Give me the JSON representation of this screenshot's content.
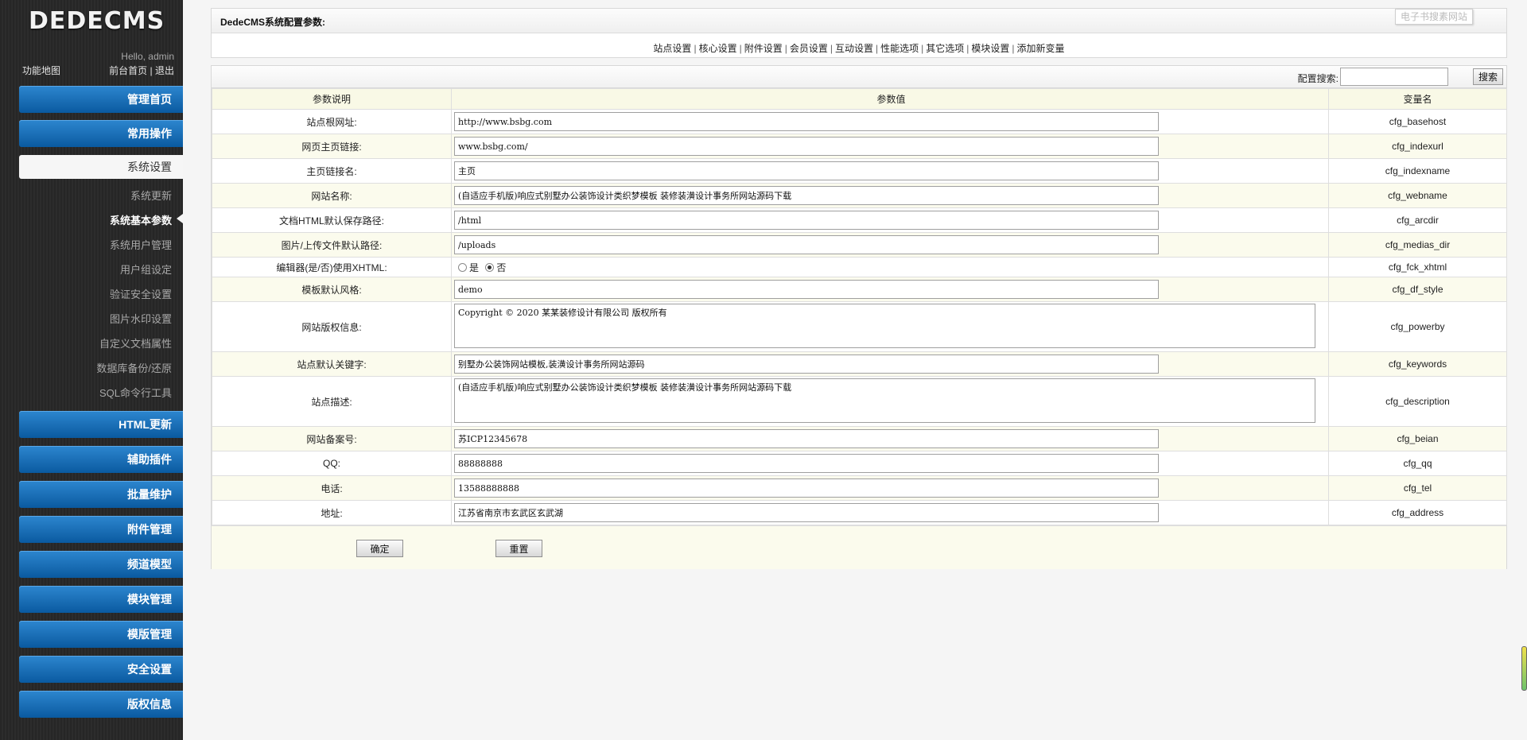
{
  "sidebar": {
    "logo": "DEDECMS",
    "hello": "Hello, admin",
    "sitemap": "功能地图",
    "frontpage": "前台首页",
    "link_sep": "|",
    "logout": "退出",
    "menu_top": [
      {
        "label": "管理首页"
      },
      {
        "label": "常用操作"
      }
    ],
    "system_settings": "系统设置",
    "sub_items": [
      {
        "label": "系统更新"
      },
      {
        "label": "系统基本参数"
      },
      {
        "label": "系统用户管理"
      },
      {
        "label": "用户组设定"
      },
      {
        "label": "验证安全设置"
      },
      {
        "label": "图片水印设置"
      },
      {
        "label": "自定义文档属性"
      },
      {
        "label": "数据库备份/还原"
      },
      {
        "label": "SQL命令行工具"
      }
    ],
    "current_sub": "系统基本参数",
    "menu_bottom": [
      {
        "label": "HTML更新"
      },
      {
        "label": "辅助插件"
      },
      {
        "label": "批量维护"
      },
      {
        "label": "附件管理"
      },
      {
        "label": "频道模型"
      },
      {
        "label": "模块管理"
      },
      {
        "label": "模版管理"
      },
      {
        "label": "安全设置"
      },
      {
        "label": "版权信息"
      }
    ]
  },
  "header": {
    "title": "DedeCMS系统配置参数:",
    "watermark": "电子书搜素网站",
    "tab_sep": "|",
    "tabs": [
      {
        "label": "站点设置"
      },
      {
        "label": "核心设置"
      },
      {
        "label": "附件设置"
      },
      {
        "label": "会员设置"
      },
      {
        "label": "互动设置"
      },
      {
        "label": "性能选项"
      },
      {
        "label": "其它选项"
      },
      {
        "label": "模块设置"
      },
      {
        "label": "添加新变量"
      }
    ]
  },
  "search": {
    "label": "配置搜索:",
    "value": "",
    "button": "搜索"
  },
  "table": {
    "headers": {
      "desc": "参数说明",
      "value": "参数值",
      "var": "变量名"
    },
    "rows": [
      {
        "desc": "站点根网址:",
        "value": "http://www.bsbg.com",
        "var": "cfg_basehost"
      },
      {
        "desc": "网页主页链接:",
        "value": "www.bsbg.com/",
        "var": "cfg_indexurl"
      },
      {
        "desc": "主页链接名:",
        "value": "主页",
        "var": "cfg_indexname"
      },
      {
        "desc": "网站名称:",
        "value": "(自适应手机版)响应式别墅办公装饰设计类织梦模板 装修装潢设计事务所网站源码下载",
        "var": "cfg_webname"
      },
      {
        "desc": "文档HTML默认保存路径:",
        "value": "/html",
        "var": "cfg_arcdir"
      },
      {
        "desc": "图片/上传文件默认路径:",
        "value": "/uploads",
        "var": "cfg_medias_dir"
      },
      {
        "desc": "编辑器(是/否)使用XHTML:",
        "radio_yes": "是",
        "radio_no": "否",
        "var": "cfg_fck_xhtml"
      },
      {
        "desc": "模板默认风格:",
        "value": "demo",
        "var": "cfg_df_style"
      },
      {
        "desc": "网站版权信息:",
        "value": "Copyright © 2020 某某装修设计有限公司 版权所有",
        "var": "cfg_powerby"
      },
      {
        "desc": "站点默认关键字:",
        "value": "别墅办公装饰网站模板,装潢设计事务所网站源码",
        "var": "cfg_keywords"
      },
      {
        "desc": "站点描述:",
        "value": "(自适应手机版)响应式别墅办公装饰设计类织梦模板 装修装潢设计事务所网站源码下载",
        "var": "cfg_description"
      },
      {
        "desc": "网站备案号:",
        "value": "苏ICP12345678",
        "var": "cfg_beian"
      },
      {
        "desc": "QQ:",
        "value": "88888888",
        "var": "cfg_qq"
      },
      {
        "desc": "电话:",
        "value": "13588888888",
        "var": "cfg_tel"
      },
      {
        "desc": "地址:",
        "value": "江苏省南京市玄武区玄武湖",
        "var": "cfg_address"
      }
    ]
  },
  "footer": {
    "ok": "确定",
    "reset": "重置"
  },
  "colors": {
    "menu_blue": "#0a5aa0",
    "row_tint": "#fbfbed"
  }
}
